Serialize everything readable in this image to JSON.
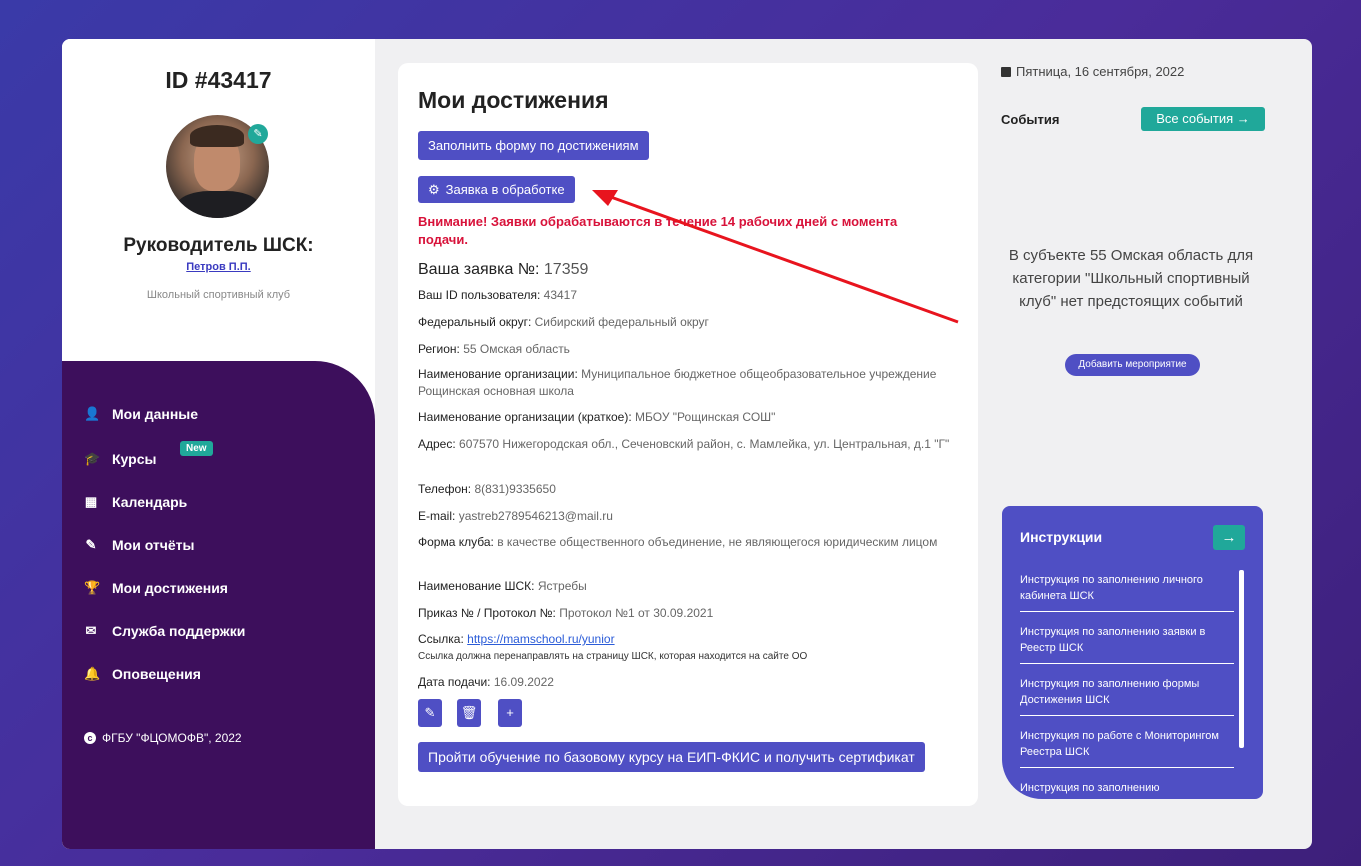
{
  "sidebar": {
    "id_title": "ID #43417",
    "role": "Руководитель ШСК:",
    "role_name": "Петров П.П.",
    "role_sub": "Школьный спортивный клуб",
    "nav": [
      {
        "label": "Мои данные",
        "icon": "user-icon"
      },
      {
        "label": "Курсы",
        "icon": "graduation-cap-icon"
      },
      {
        "label": "Календарь",
        "icon": "calendar-icon"
      },
      {
        "label": "Мои отчёты",
        "icon": "edit-icon"
      },
      {
        "label": "Мои достижения",
        "icon": "trophy-icon"
      },
      {
        "label": "Служба поддержки",
        "icon": "envelope-icon"
      },
      {
        "label": "Оповещения",
        "icon": "bell-icon"
      }
    ],
    "new_badge": "New",
    "copyright": "ФГБУ \"ФЦОМОФВ\", 2022"
  },
  "main": {
    "title": "Мои достижения",
    "fill_form_button": "Заполнить форму по достижениям",
    "status_button": "Заявка в обработке",
    "warning": "Внимание! Заявки обрабатываются в течение 14 рабочих дней с момента подачи.",
    "app_number_label": "Ваша заявка №:",
    "app_number": "17359",
    "fields": [
      {
        "label": "Ваш ID пользователя:",
        "value": "43417"
      },
      {
        "label": "Федеральный округ:",
        "value": "Сибирский федеральный округ"
      },
      {
        "label": "Регион:",
        "value": "55 Омская область"
      },
      {
        "label": "Наименование организации:",
        "value": "Муниципальное бюджетное общеобразовательное учреждение Рощинская основная школа"
      },
      {
        "label": "Наименование организации (краткое):",
        "value": "МБОУ \"Рощинская СОШ\""
      },
      {
        "label": "Адрес:",
        "value": "607570 Нижегородская обл., Сеченовский район, с. Мамлейка, ул. Центральная, д.1 \"Г\""
      },
      {
        "label": "Телефон:",
        "value": "8(831)9335650"
      },
      {
        "label": "E-mail:",
        "value": "yastreb2789546213@mail.ru"
      },
      {
        "label": "Форма клуба:",
        "value": "в качестве общественного объединение, не являющегося юридическим лицом"
      },
      {
        "label": "Наименование ШСК:",
        "value": "Ястребы"
      },
      {
        "label": "Приказ № / Протокол №:",
        "value": "Протокол №1 от 30.09.2021"
      }
    ],
    "link_label": "Ссылка:",
    "link_value": "https://mamschool.ru/yunior",
    "link_note": "Ссылка должна перенаправлять на страницу ШСК, которая находится на сайте ОО",
    "date_label": "Дата подачи:",
    "date_value": "16.09.2022",
    "course_button": "Пройти обучение по базовому курсу на ЕИП-ФКИС и получить сертификат"
  },
  "right": {
    "date": "Пятница, 16 сентября, 2022",
    "events_title": "События",
    "all_events_button": "Все события →",
    "no_events": "В субъекте 55 Омская область для категории \"Школьный спортивный клуб\" нет предстоящих событий",
    "add_event_button": "Добавить мероприятие",
    "instructions_title": "Инструкции",
    "instructions_go": "→",
    "instructions": [
      "Инструкция по заполнению личного кабинета ШСК",
      "Инструкция по заполнению заявки в Реестр ШСК",
      "Инструкция по заполнению формы Достижения ШСК",
      "Инструкция по работе с Мониторингом Реестра ШСК",
      "Инструкция по заполнению"
    ]
  },
  "colors": {
    "accent": "#4f4fc4",
    "teal": "#20a89a",
    "nav_bg": "#3d0f5c",
    "warning": "#d8123a",
    "annotation_arrow": "#e8141e"
  }
}
